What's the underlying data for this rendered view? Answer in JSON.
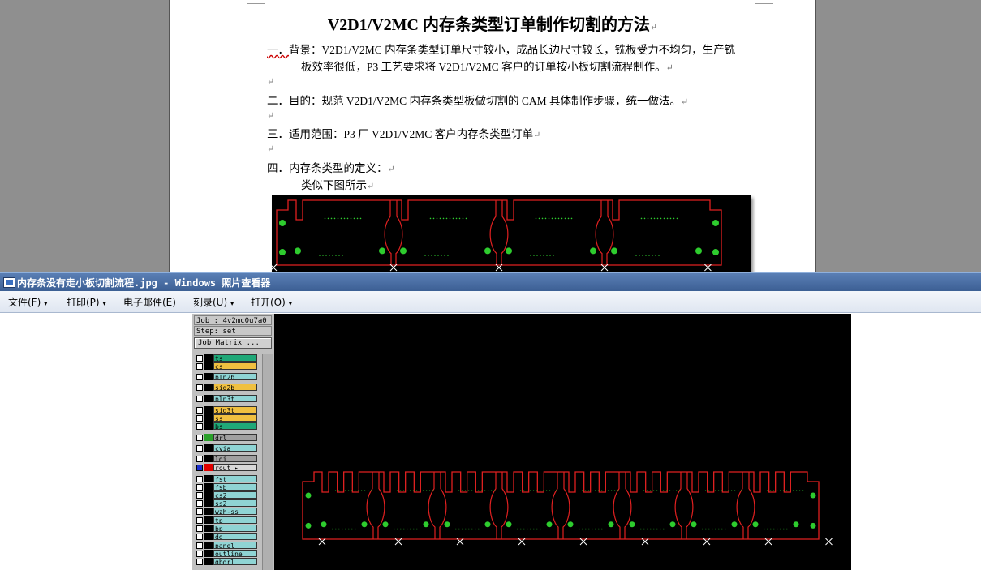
{
  "document": {
    "title": "V2D1/V2MC 内存条类型订单制作切割的方法",
    "paragraphs": [
      {
        "num": "一．",
        "line1": "背景：V2D1/V2MC 内存条类型订单尺寸较小，成品长边尺寸较长，铣板受力不均匀，生产铣",
        "line2": "板效率很低，P3 工艺要求将 V2D1/V2MC 客户的订单按小板切割流程制作。"
      },
      {
        "num": "二．",
        "line1": "目的：规范 V2D1/V2MC 内存条类型板做切割的 CAM 具体制作步骤，统一做法。"
      },
      {
        "num": "三．",
        "line1": "适用范围：P3 厂 V2D1/V2MC 客户内存条类型订单"
      },
      {
        "num": "四．",
        "line1": "内存条类型的定义：",
        "line2": "类似下图所示"
      }
    ],
    "return_mark": "↵"
  },
  "window": {
    "title": "内存条没有走小板切割流程.jpg - Windows 照片查看器",
    "menu": [
      {
        "label": "文件(F)",
        "has_arrow": true
      },
      {
        "label": "打印(P)",
        "has_arrow": true
      },
      {
        "label": "电子邮件(E)",
        "has_arrow": false
      },
      {
        "label": "刻录(U)",
        "has_arrow": true
      },
      {
        "label": "打开(O)",
        "has_arrow": true
      }
    ],
    "menu_arrow": "▾"
  },
  "cam": {
    "job": "Job : 4v2mc0u7a0",
    "step": "Step: set",
    "matrix_button": "Job Matrix ...",
    "layers": [
      {
        "name": "ts",
        "color": "#1fa878",
        "swatch": "#000000"
      },
      {
        "name": "cs",
        "color": "#f0c040",
        "swatch": "#000000"
      },
      {
        "name": "pln2b",
        "color": "#8fd4d4",
        "swatch": "#000000"
      },
      {
        "name": "sig2b",
        "color": "#f0c040",
        "swatch": "#000000"
      },
      {
        "name": "pln3t",
        "color": "#8fd4d4",
        "swatch": "#000000"
      },
      {
        "name": "sig3t",
        "color": "#f0c040",
        "swatch": "#000000"
      },
      {
        "name": "ss",
        "color": "#f0c040",
        "swatch": "#000000"
      },
      {
        "name": "bs",
        "color": "#1fa878",
        "swatch": "#000000"
      },
      {
        "name": "drl",
        "color": "#a0a0a0",
        "swatch": "#2aa02a"
      },
      {
        "name": "cvia",
        "color": "#8fd4d4",
        "swatch": "#000000"
      },
      {
        "name": "ldi",
        "color": "#a0a0a0",
        "swatch": "#000000"
      },
      {
        "name": "rout",
        "color": "#d8d8d8",
        "swatch": "#e00000"
      },
      {
        "name": "fst",
        "color": "#8fd4d4",
        "swatch": "#000000"
      },
      {
        "name": "fsb",
        "color": "#8fd4d4",
        "swatch": "#000000"
      },
      {
        "name": "cs2",
        "color": "#8fd4d4",
        "swatch": "#000000"
      },
      {
        "name": "ss2",
        "color": "#8fd4d4",
        "swatch": "#000000"
      },
      {
        "name": "wzh-ss",
        "color": "#8fd4d4",
        "swatch": "#000000"
      },
      {
        "name": "tp",
        "color": "#8fd4d4",
        "swatch": "#000000"
      },
      {
        "name": "bp",
        "color": "#8fd4d4",
        "swatch": "#000000"
      },
      {
        "name": "dd",
        "color": "#8fd4d4",
        "swatch": "#000000"
      },
      {
        "name": "panel",
        "color": "#8fd4d4",
        "swatch": "#000000"
      },
      {
        "name": "outline",
        "color": "#8fd4d4",
        "swatch": "#000000"
      },
      {
        "name": "gbdrl",
        "color": "#8fd4d4",
        "swatch": "#000000"
      }
    ],
    "rout_arrow": "▸"
  },
  "colors": {
    "rout_line": "#e02020",
    "pad": "#2ecc2e",
    "title_bar": "#4a6fa5"
  }
}
